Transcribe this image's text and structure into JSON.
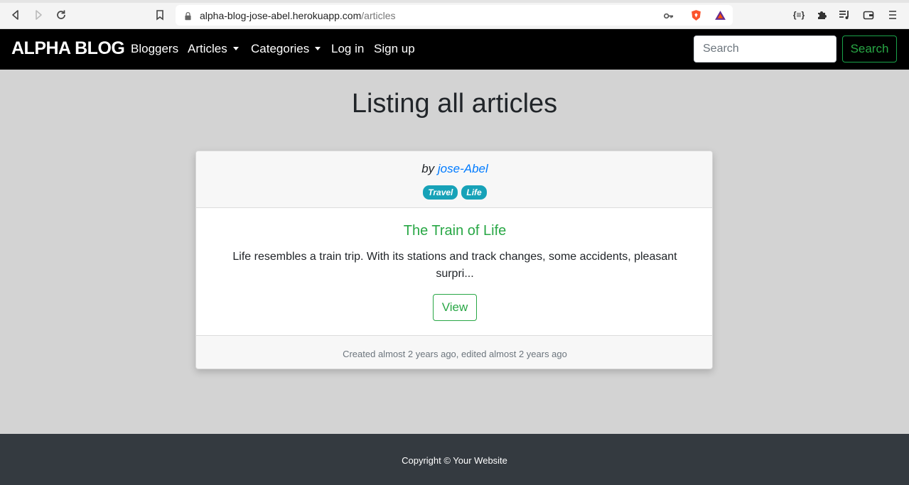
{
  "browser": {
    "url_host": "alpha-blog-jose-abel.herokuapp.com",
    "url_path": "/articles"
  },
  "navbar": {
    "brand": "ALPHA BLOG",
    "links": {
      "bloggers": "Bloggers",
      "articles": "Articles",
      "categories": "Categories",
      "login": "Log in",
      "signup": "Sign up"
    },
    "search_placeholder": "Search",
    "search_button": "Search"
  },
  "main": {
    "title": "Listing all articles",
    "articles": [
      {
        "by": "by",
        "author": "jose-Abel",
        "categories": [
          "Travel",
          "Life"
        ],
        "title": "The Train of Life",
        "excerpt": "Life resembles a train trip. With its stations and track changes, some accidents, pleasant surpri...",
        "view_label": "View",
        "meta": "Created almost 2 years ago, edited almost 2 years ago"
      }
    ]
  },
  "footer": {
    "text": "Copyright © Your Website"
  },
  "colors": {
    "accent_green": "#28a745",
    "badge_teal": "#17a2b8",
    "link_blue": "#007bff",
    "page_bg": "#d3d3d3",
    "footer_bg": "#343a40"
  }
}
